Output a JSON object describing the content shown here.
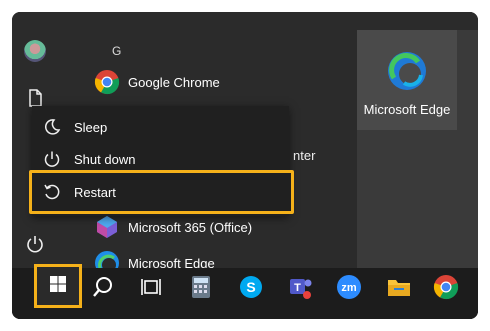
{
  "apps": {
    "section_letter": "G",
    "items": [
      {
        "label": "Google Chrome",
        "icon": "chrome-icon"
      },
      {
        "label": "Microsoft 365 (Office)",
        "icon": "office-icon"
      },
      {
        "label": "Microsoft Edge",
        "icon": "edge-icon"
      }
    ]
  },
  "tile": {
    "label": "Microsoft Edge",
    "icon": "edge-icon"
  },
  "power_menu": {
    "items": [
      {
        "label": "Sleep",
        "icon": "moon-icon"
      },
      {
        "label": "Shut down",
        "icon": "power-icon"
      },
      {
        "label": "Restart",
        "icon": "restart-icon"
      }
    ]
  },
  "peek_text": "nter",
  "taskbar": {
    "icons": [
      "windows-start-icon",
      "search-icon",
      "task-view-icon",
      "calculator-icon",
      "skype-icon",
      "teams-icon",
      "zoom-icon",
      "file-explorer-icon",
      "chrome-icon"
    ],
    "zoom_label": "zm"
  },
  "colors": {
    "highlight": "#f5b11a",
    "start_bg": "#2b2b2b",
    "taskbar": "#1c1c1c"
  }
}
